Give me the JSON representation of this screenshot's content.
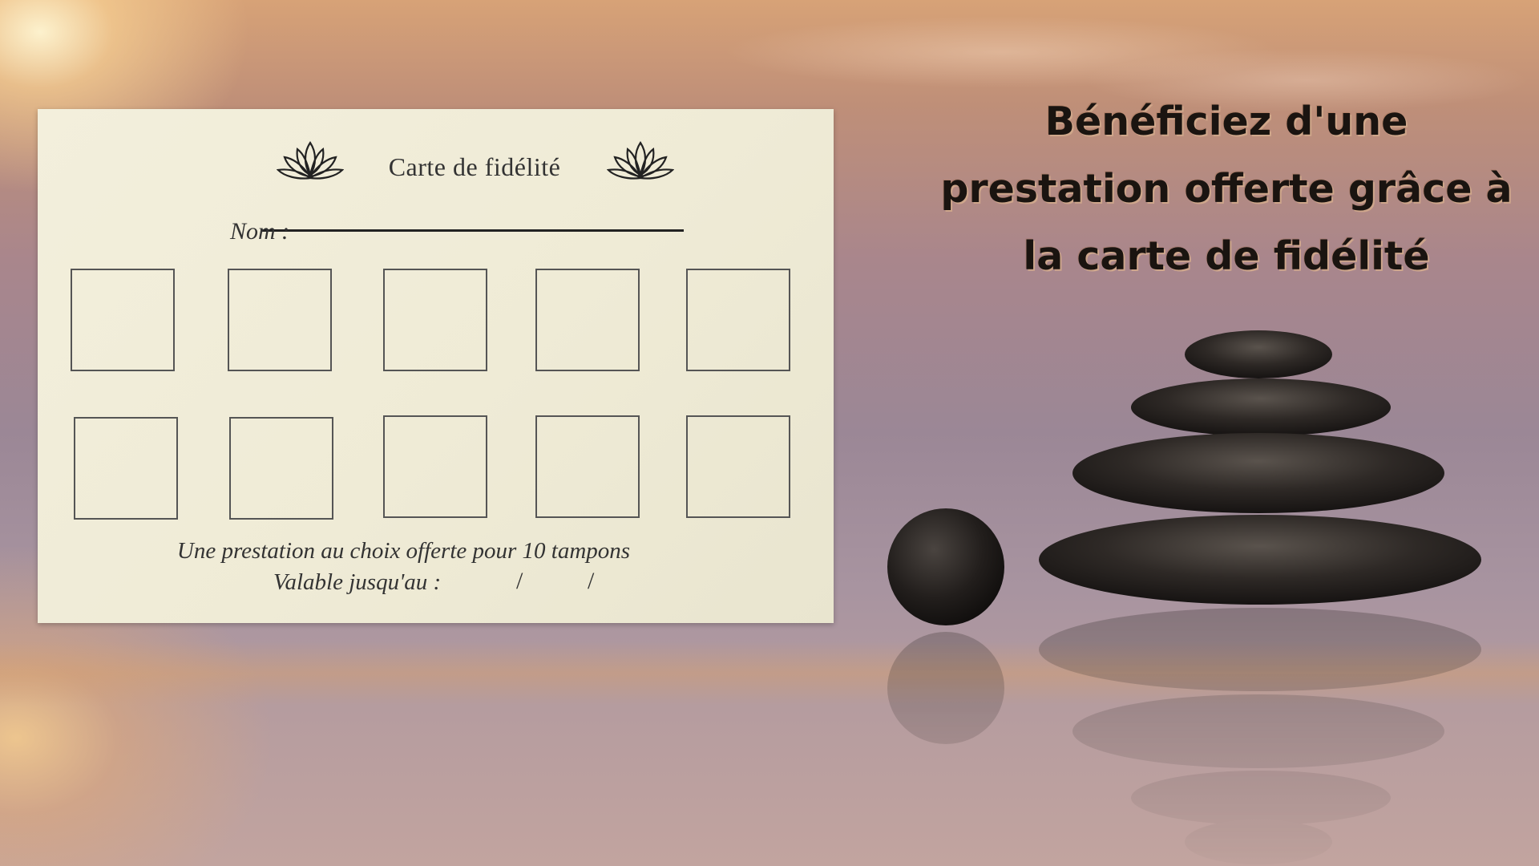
{
  "card": {
    "title": "Carte de fidélité",
    "name_label": "Nom :",
    "stamp_count": 10,
    "offer_text": "Une prestation au choix offerte pour 10 tampons",
    "validity_label": "Valable jusqu'au :",
    "date_separator": "/"
  },
  "headline": {
    "lines": [
      "Bénéficiez d'une",
      "prestation offerte grâce à",
      "la carte de fidélité"
    ]
  },
  "colors": {
    "card_paper": "#efebd6",
    "headline_text": "#1a1410",
    "stone": "#2a2522"
  },
  "icons": [
    "lotus-icon",
    "lotus-icon"
  ]
}
